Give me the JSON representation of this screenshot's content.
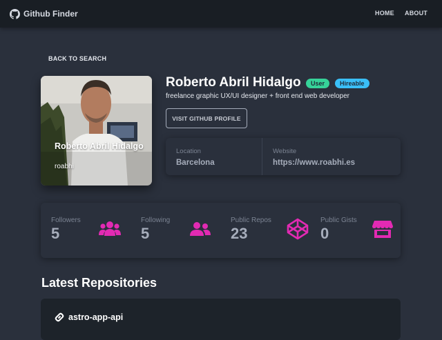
{
  "app": {
    "title": "Github Finder",
    "nav": [
      {
        "label": "HOME"
      },
      {
        "label": "ABOUT"
      }
    ]
  },
  "actions": {
    "back_label": "BACK TO SEARCH",
    "visit_profile_label": "VISIT GITHUB PROFILE"
  },
  "user": {
    "name": "Roberto Abril Hidalgo",
    "login": "roabhi",
    "bio": "freelance graphic UX/UI designer + front end web developer",
    "badges": [
      {
        "label": "User",
        "color": "#36d399"
      },
      {
        "label": "Hireable",
        "color": "#3abff8"
      }
    ],
    "info": [
      {
        "label": "Location",
        "value": "Barcelona"
      },
      {
        "label": "Website",
        "value": "https://www.roabhi.es"
      }
    ]
  },
  "stats": [
    {
      "label": "Followers",
      "value": "5",
      "icon": "users-icon"
    },
    {
      "label": "Following",
      "value": "5",
      "icon": "user-friends-icon"
    },
    {
      "label": "Public Repos",
      "value": "23",
      "icon": "codepen-icon"
    },
    {
      "label": "Public Gists",
      "value": "0",
      "icon": "store-icon"
    }
  ],
  "repos": {
    "title": "Latest Repositories",
    "items": [
      {
        "name": "astro-app-api",
        "icon": "link-icon"
      }
    ]
  },
  "theme": {
    "accent": "#e22ab3",
    "background": "#2a303c",
    "navbar": "#191e24"
  }
}
